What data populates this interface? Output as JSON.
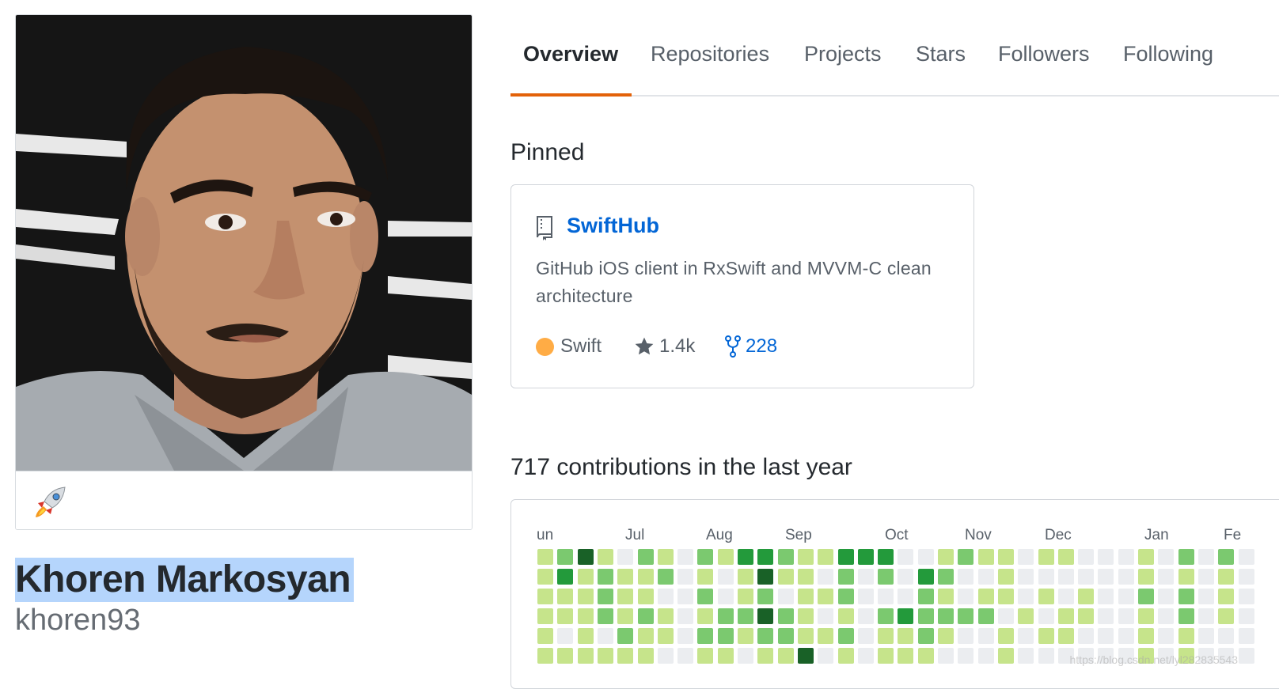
{
  "profile": {
    "full_name": "Khoren Markosyan",
    "username": "khoren93",
    "status_emoji": "rocket-icon"
  },
  "tabs": [
    {
      "label": "Overview",
      "active": true
    },
    {
      "label": "Repositories",
      "active": false
    },
    {
      "label": "Projects",
      "active": false
    },
    {
      "label": "Stars",
      "active": false
    },
    {
      "label": "Followers",
      "active": false
    },
    {
      "label": "Following",
      "active": false
    }
  ],
  "pinned": {
    "heading": "Pinned",
    "repo": {
      "icon": "repo-icon",
      "name": "SwiftHub",
      "description": "GitHub iOS client in RxSwift and MVVM-C clean architecture",
      "language": "Swift",
      "language_color": "#ffac45",
      "stars": "1.4k",
      "forks": "228"
    }
  },
  "contributions": {
    "heading": "717 contributions in the last year",
    "months": [
      "un",
      "Jul",
      "Aug",
      "Sep",
      "Oct",
      "Nov",
      "Dec",
      "Jan",
      "Fe"
    ],
    "levels": [
      [
        1,
        2,
        4,
        1,
        0,
        2,
        1,
        0,
        2,
        1,
        3,
        3,
        2,
        1,
        1,
        3,
        3,
        3,
        0,
        0,
        1,
        2,
        1,
        1,
        0,
        1,
        1,
        0,
        0,
        0,
        1,
        0,
        2,
        0,
        2,
        0
      ],
      [
        1,
        3,
        1,
        2,
        1,
        1,
        2,
        0,
        1,
        0,
        1,
        4,
        1,
        1,
        0,
        2,
        0,
        2,
        0,
        3,
        2,
        0,
        0,
        1,
        0,
        0,
        0,
        0,
        0,
        0,
        1,
        0,
        1,
        0,
        1,
        0
      ],
      [
        1,
        1,
        1,
        2,
        1,
        1,
        0,
        0,
        2,
        0,
        1,
        2,
        0,
        1,
        1,
        2,
        0,
        0,
        0,
        2,
        1,
        0,
        1,
        1,
        0,
        1,
        0,
        1,
        0,
        0,
        2,
        0,
        2,
        0,
        1,
        0
      ],
      [
        1,
        1,
        1,
        2,
        1,
        2,
        1,
        0,
        1,
        2,
        2,
        4,
        2,
        1,
        0,
        1,
        0,
        2,
        3,
        2,
        2,
        2,
        2,
        0,
        1,
        0,
        1,
        1,
        0,
        0,
        1,
        0,
        2,
        0,
        1,
        0
      ],
      [
        1,
        0,
        1,
        0,
        2,
        1,
        1,
        0,
        2,
        2,
        1,
        2,
        2,
        1,
        1,
        2,
        0,
        1,
        1,
        2,
        1,
        0,
        0,
        1,
        0,
        1,
        1,
        0,
        0,
        0,
        1,
        0,
        1,
        0,
        0,
        0
      ],
      [
        1,
        1,
        1,
        1,
        1,
        1,
        0,
        0,
        1,
        1,
        0,
        1,
        1,
        4,
        0,
        1,
        0,
        1,
        1,
        1,
        0,
        0,
        0,
        1,
        0,
        0,
        0,
        0,
        0,
        0,
        1,
        0,
        1,
        0,
        0,
        0
      ]
    ],
    "level_colors": [
      "#ebedf0",
      "#c6e48b",
      "#7bc96f",
      "#239a3b",
      "#196127"
    ]
  },
  "watermark": "https://blog.csdn.net/lyl282835543"
}
